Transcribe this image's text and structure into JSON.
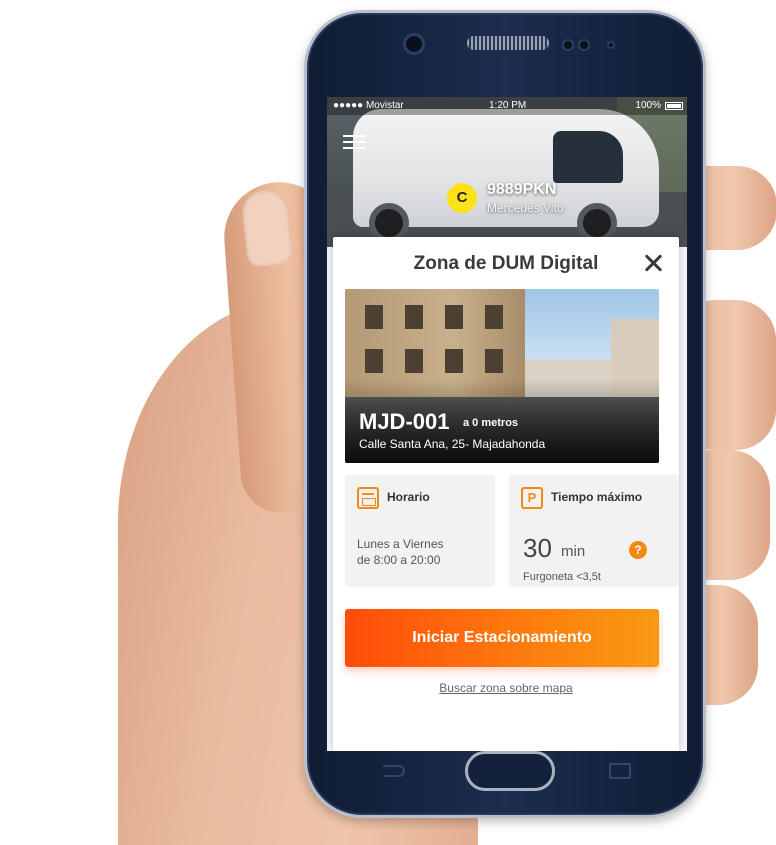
{
  "status_bar": {
    "carrier": "●●●●● Movistar",
    "time": "1:20 PM",
    "battery": "100%"
  },
  "vehicle": {
    "badge": "C",
    "plate": "9889PKN",
    "model": "Mercedes Vito"
  },
  "modal": {
    "title": "Zona de DUM Digital",
    "zone": {
      "code": "MJD-001",
      "distance": "a 0 metros",
      "address": "Calle Santa Ana, 25- Majadahonda"
    },
    "schedule": {
      "title": "Horario",
      "line1": "Lunes a Viernes",
      "line2": "de 8:00 a 20:00"
    },
    "max_time": {
      "icon_letter": "P",
      "title": "Tiempo máximo",
      "value": "30",
      "unit": "min",
      "help": "?",
      "vehicle_type": "Furgoneta <3,5t"
    },
    "start_button": "Iniciar Estacionamiento",
    "map_link": "Buscar zona sobre mapa"
  },
  "colors": {
    "accent": "#f28a12",
    "button_start": "#ff4c0a",
    "button_end": "#f79a12",
    "badge": "#ffe11a",
    "phone_body": "#1c2d4e"
  }
}
